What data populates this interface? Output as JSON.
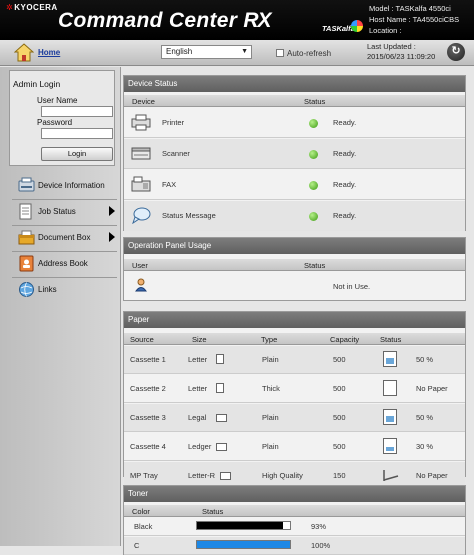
{
  "header": {
    "brand": "KYOCERA",
    "app_title": "Command Center",
    "app_title_suffix": "RX",
    "product_logo": "TASKalfa",
    "model_line": "Model : TASKalfa 4550ci",
    "host_line": "Host Name : TA4550ciCBS",
    "location_line": "Location :"
  },
  "navbar": {
    "home_label": "Home",
    "language": "English",
    "auto_refresh_label": "Auto-refresh",
    "last_updated_label": "Last Updated :",
    "last_updated_value": "2015/06/23 11:09:20",
    "refresh_icon": "refresh-icon"
  },
  "login": {
    "title": "Admin Login",
    "user_label": "User Name",
    "password_label": "Password",
    "button": "Login"
  },
  "sidebar": {
    "items": [
      {
        "label": "Device Information",
        "icon": "device-info-icon"
      },
      {
        "label": "Job Status",
        "icon": "job-status-icon"
      },
      {
        "label": "Document Box",
        "icon": "document-box-icon"
      },
      {
        "label": "Address Book",
        "icon": "address-book-icon"
      },
      {
        "label": "Links",
        "icon": "links-icon"
      }
    ]
  },
  "device_status": {
    "title": "Device Status",
    "col_device": "Device",
    "col_status": "Status",
    "rows": [
      {
        "device": "Printer",
        "status": "Ready."
      },
      {
        "device": "Scanner",
        "status": "Ready."
      },
      {
        "device": "FAX",
        "status": "Ready."
      },
      {
        "device": "Status Message",
        "status": "Ready."
      }
    ],
    "status_color": "#4caf1a"
  },
  "operation_panel": {
    "title": "Operation Panel Usage",
    "col_user": "User",
    "col_status": "Status",
    "status": "Not in Use."
  },
  "paper": {
    "title": "Paper",
    "cols": {
      "source": "Source",
      "size": "Size",
      "type": "Type",
      "capacity": "Capacity",
      "status": "Status"
    },
    "rows": [
      {
        "source": "Cassette 1",
        "size": "Letter",
        "type": "Plain",
        "capacity": "500",
        "status": "50 %",
        "level": 0.5
      },
      {
        "source": "Cassette 2",
        "size": "Letter",
        "type": "Thick",
        "capacity": "500",
        "status": "No Paper",
        "level": 0
      },
      {
        "source": "Cassette 3",
        "size": "Legal",
        "type": "Plain",
        "capacity": "500",
        "status": "50 %",
        "level": 0.5
      },
      {
        "source": "Cassette 4",
        "size": "Ledger",
        "type": "Plain",
        "capacity": "500",
        "status": "30 %",
        "level": 0.3
      },
      {
        "source": "MP Tray",
        "size": "Letter-R",
        "type": "High Quality",
        "capacity": "150",
        "status": "No Paper",
        "level": 0
      }
    ]
  },
  "toner": {
    "title": "Toner",
    "col_color": "Color",
    "col_status": "Status",
    "rows": [
      {
        "color": "Black",
        "percent": "93%",
        "level": 0.93,
        "hex": "#000000"
      },
      {
        "color": "C",
        "percent": "100%",
        "level": 1.0,
        "hex": "#1e88e5"
      }
    ]
  }
}
